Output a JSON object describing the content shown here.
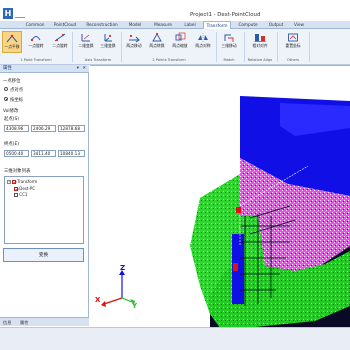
{
  "window": {
    "title": "Project1 - Dest-PointCloud",
    "logo_text": "H"
  },
  "menu": {
    "tabs": [
      "Common",
      "PointCloud",
      "Reconstruction",
      "Model",
      "Measure",
      "Label",
      "Transform",
      "Compute",
      "Output",
      "View"
    ],
    "active_tab": "Transform"
  },
  "ribbon": {
    "groups": [
      {
        "label": "1 Point Transform",
        "buttons": [
          "一点平移",
          "一点旋转",
          "二点旋转"
        ]
      },
      {
        "label": "Axis Transform",
        "buttons": [
          "二维变换",
          "三维变换"
        ]
      },
      {
        "label": "2 Points Transform",
        "buttons": [
          "两点移动",
          "两点转换",
          "两点缩放",
          "两点对称"
        ]
      },
      {
        "label": "Match",
        "buttons": [
          "三维移动"
        ]
      },
      {
        "label": "Relative Align",
        "buttons": [
          "相对对齐"
        ]
      },
      {
        "label": "Others",
        "buttons": [
          "重置坐标"
        ]
      }
    ],
    "active_button": "一点平移"
  },
  "panel": {
    "title": "属性",
    "header_buttons": "▾ ✕",
    "section1_label": "一点移位",
    "radio1_label": "点对点",
    "radio2_label": "按坐标",
    "radio_selected": 2,
    "section2_label": "Vol修改",
    "field_group1_label": "起点(S)",
    "field_row1": [
      "4308.96",
      "2406.29",
      "12878.68"
    ],
    "field_group2_label": "终点(E)",
    "field_row2": [
      "0500.40",
      "3411.40",
      "10840.13"
    ],
    "tree_title": "三维对象列表",
    "tree": {
      "root": "Transform",
      "children": [
        "Dest-PC",
        "CC1"
      ]
    },
    "confirm_label": "变换"
  },
  "bottom_tabs": [
    "信息",
    "属性"
  ],
  "viewport": {
    "axes": {
      "x": "X",
      "y": "Y",
      "z": "Z"
    },
    "colors": {
      "blue": "#1010e6",
      "magenta": "#ff30ff",
      "green": "#28dc28",
      "red": "#e01010",
      "dark": "#0a0a26"
    }
  }
}
